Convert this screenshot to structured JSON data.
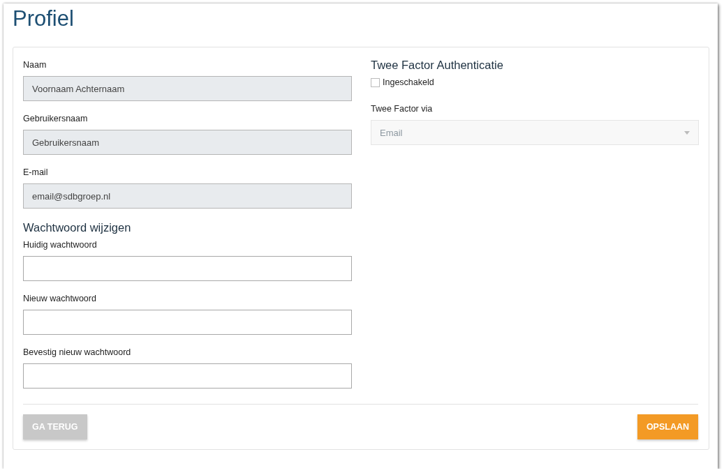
{
  "title": "Profiel",
  "account_fields": [
    {
      "label": "Naam",
      "value": "Voornaam Achternaam",
      "disabled": true
    },
    {
      "label": "Gebruikersnaam",
      "value": "Gebruikersnaam",
      "disabled": true
    },
    {
      "label": "E-mail",
      "value": "email@sdbgroep.nl",
      "disabled": true
    }
  ],
  "password_section": {
    "heading": "Wachtwoord wijzigen",
    "fields": [
      {
        "label": "Huidig wachtwoord",
        "disabled": false
      },
      {
        "label": "Nieuw wachtwoord",
        "disabled": false
      },
      {
        "label": "Bevestig nieuw wachtwoord",
        "disabled": false
      }
    ]
  },
  "two_factor": {
    "heading": "Twee Factor Authenticatie",
    "enabled": {
      "label": "Ingeschakeld",
      "checked": false
    },
    "method": {
      "label": "Twee Factor via",
      "value": "Email",
      "disabled": true
    }
  },
  "buttons": [
    {
      "label": "GA TERUG",
      "kind": "secondary"
    },
    {
      "label": "OPSLAAN",
      "kind": "primary"
    }
  ]
}
